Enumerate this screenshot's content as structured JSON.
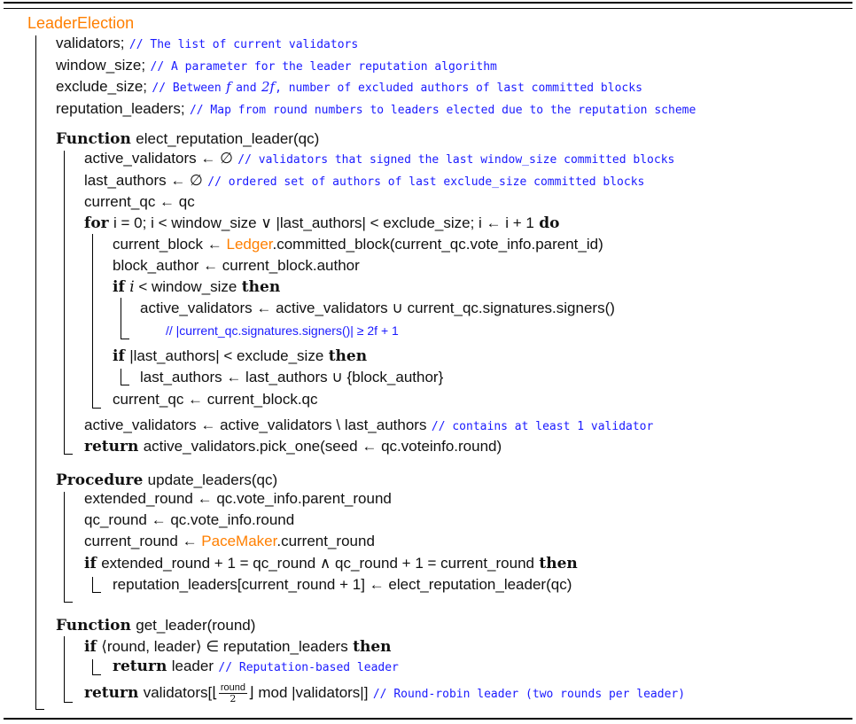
{
  "algo": {
    "name": "LeaderElection",
    "decl": [
      {
        "name": "validators;",
        "comment": "// The list of current validators"
      },
      {
        "name": "window_size;",
        "comment": "// A parameter for the leader reputation algorithm"
      },
      {
        "name": "exclude_size;",
        "comment_a": "// Between",
        "f": "f",
        "and": "and",
        "twof": "2f",
        "comment_b": ", number of excluded authors of last committed blocks"
      },
      {
        "name": "reputation_leaders;",
        "comment": "// Map from round numbers to leaders elected due to the reputation scheme"
      }
    ],
    "elect": {
      "kw": "Function",
      "sig": "elect_reputation_leader(qc)",
      "l1": "active_validators ← ∅",
      "l1c": "// validators that signed the last window_size committed blocks",
      "l2": "last_authors ← ∅",
      "l2c": "// ordered set of authors of last exclude_size committed blocks",
      "l3": "current_qc ← qc",
      "for_kw": "for",
      "for_body": "i = 0; i < window_size ∨ |last_authors| < exclude_size; i ← i + 1",
      "do_kw": "do",
      "f1a": "current_block ← ",
      "f1b": "Ledger",
      "f1c": ".committed_block(current_qc.vote_info.parent_id)",
      "f2": "block_author ← current_block.author",
      "if1_kw": "if",
      "if1_i": "i",
      "if1_rest": " < window_size",
      "then_kw": "then",
      "if1_b1": "active_validators ← active_validators ∪ current_qc.signatures.signers()",
      "if1_c1": "// |current_qc.signatures.signers()| ≥ 2f + 1",
      "if2_kw": "if",
      "if2_rest": "|last_authors| < exclude_size",
      "if2_b1": "last_authors ← last_authors ∪ {block_author}",
      "f3": "current_qc ← current_block.qc",
      "l4": "active_validators ← active_validators \\ last_authors",
      "l4c": "// contains at least 1 validator",
      "ret_kw": "return",
      "ret": "active_validators.pick_one(seed ← qc.voteinfo.round)"
    },
    "update": {
      "kw": "Procedure",
      "sig": "update_leaders(qc)",
      "l1": "extended_round ← qc.vote_info.parent_round",
      "l2": "qc_round ← qc.vote_info.round",
      "l3a": "current_round ← ",
      "l3b": "PaceMaker",
      "l3c": ".current_round",
      "if_kw": "if",
      "if_rest": "extended_round + 1 = qc_round ∧ qc_round + 1 = current_round",
      "then_kw": "then",
      "if_b1": "reputation_leaders[current_round + 1] ← elect_reputation_leader(qc)"
    },
    "getleader": {
      "kw": "Function",
      "sig": "get_leader(round)",
      "if_kw": "if",
      "if_rest": "⟨round, leader⟩ ∈ reputation_leaders",
      "then_kw": "then",
      "ret_kw": "return",
      "ret1": "leader",
      "ret1c": "// Reputation-based leader",
      "ret2a": "validators[⌊",
      "frac_num": "round",
      "frac_den": "2",
      "ret2b": "⌋  mod |validators|]",
      "ret2c": "// Round-robin leader (two rounds per leader)"
    }
  }
}
